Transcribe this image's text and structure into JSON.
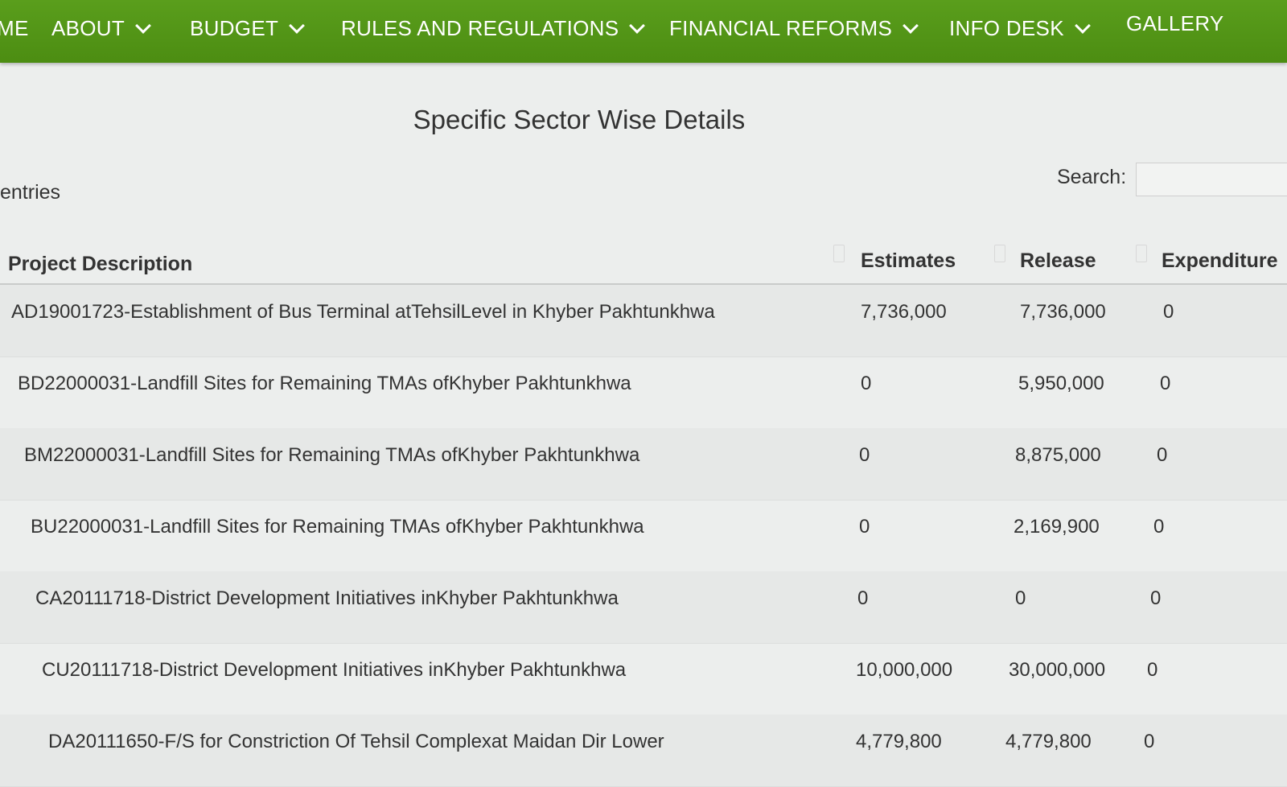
{
  "nav": {
    "items": [
      {
        "label": "ME",
        "dropdown": false
      },
      {
        "label": "ABOUT",
        "dropdown": true
      },
      {
        "label": "BUDGET",
        "dropdown": true
      },
      {
        "label": "RULES AND REGULATIONS",
        "dropdown": true
      },
      {
        "label": "FINANCIAL REFORMS",
        "dropdown": true
      },
      {
        "label": "INFO DESK",
        "dropdown": true
      },
      {
        "label": "GALLERY",
        "dropdown": false
      }
    ],
    "color": "#529a17"
  },
  "page_title": "Specific Sector Wise Details",
  "entries_label": "entries",
  "search": {
    "label": "Search:",
    "value": ""
  },
  "table": {
    "columns": [
      "Project Description",
      "Estimates",
      "Release",
      "Expenditure"
    ],
    "rows": [
      {
        "description": "AD19001723-Establishment of Bus Terminal atTehsilLevel in Khyber Pakhtunkhwa",
        "estimates": "7,736,000",
        "release": "7,736,000",
        "expenditure": "0"
      },
      {
        "description": "BD22000031-Landfill Sites for Remaining TMAs ofKhyber Pakhtunkhwa",
        "estimates": "0",
        "release": "5,950,000",
        "expenditure": "0"
      },
      {
        "description": "BM22000031-Landfill Sites for Remaining TMAs ofKhyber Pakhtunkhwa",
        "estimates": "0",
        "release": "8,875,000",
        "expenditure": "0"
      },
      {
        "description": "BU22000031-Landfill Sites for Remaining TMAs ofKhyber Pakhtunkhwa",
        "estimates": "0",
        "release": "2,169,900",
        "expenditure": "0"
      },
      {
        "description": "CA20111718-District Development Initiatives inKhyber Pakhtunkhwa",
        "estimates": "0",
        "release": "0",
        "expenditure": "0"
      },
      {
        "description": "CU20111718-District Development Initiatives inKhyber Pakhtunkhwa",
        "estimates": "10,000,000",
        "release": "30,000,000",
        "expenditure": "0"
      },
      {
        "description": "DA20111650-F/S for Constriction Of Tehsil Complexat Maidan Dir Lower",
        "estimates": "4,779,800",
        "release": "4,779,800",
        "expenditure": "0"
      }
    ]
  }
}
